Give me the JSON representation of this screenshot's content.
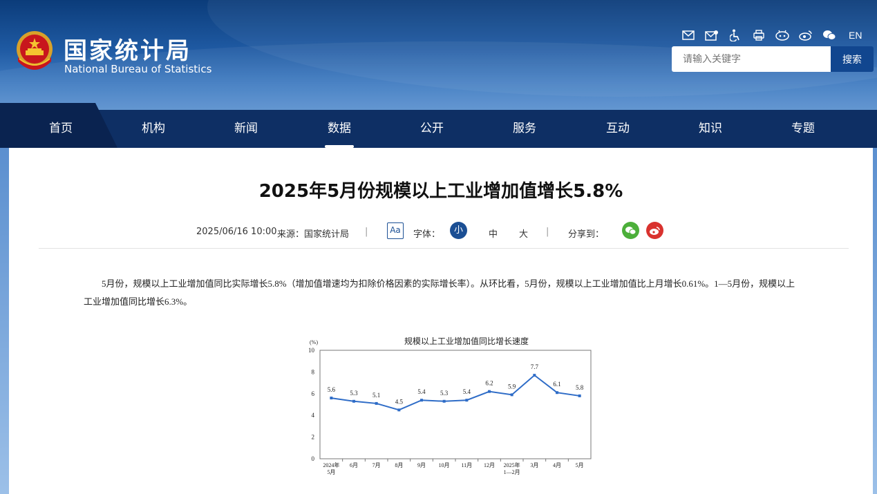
{
  "header": {
    "logo_cn": "国家统计局",
    "logo_en": "National Bureau of Statistics",
    "lang_toggle": "EN",
    "search_placeholder": "请输入关键字",
    "search_button": "搜索",
    "tool_icons": [
      "mail-icon",
      "mailbox-icon",
      "accessibility-icon",
      "print-icon",
      "mini-program-icon",
      "weibo-icon",
      "wechat-icon"
    ]
  },
  "nav": {
    "items": [
      "首页",
      "机构",
      "新闻",
      "数据",
      "公开",
      "服务",
      "互动",
      "知识",
      "专题"
    ],
    "active": "数据"
  },
  "article": {
    "title": "2025年5月份规模以上工业增加值增长5.8%",
    "date": "2025/06/16 10:00",
    "source": "来源：国家统计局",
    "aa_label": "Aa",
    "font_label": "字体：",
    "size_small": "小",
    "size_medium": "中",
    "size_large": "大",
    "share_label": "分享到：",
    "separator": "|",
    "paragraph": "5月份，规模以上工业增加值同比实际增长5.8%（增加值增速均为扣除价格因素的实际增长率）。从环比看，5月份，规模以上工业增加值比上月增长0.61%。1—5月份，规模以上工业增加值同比增长6.3%。"
  },
  "chart_data": {
    "type": "line",
    "title": "规模以上工业增加值同比增长速度",
    "ylabel": "(%)",
    "ylim": [
      0,
      10
    ],
    "yticks": [
      0,
      2,
      4,
      6,
      8,
      10
    ],
    "categories": [
      [
        "2024年",
        "5月"
      ],
      [
        "6月"
      ],
      [
        "7月"
      ],
      [
        "8月"
      ],
      [
        "9月"
      ],
      [
        "10月"
      ],
      [
        "11月"
      ],
      [
        "12月"
      ],
      [
        "2025年",
        "1—2月"
      ],
      [
        "3月"
      ],
      [
        "4月"
      ],
      [
        "5月"
      ]
    ],
    "values": [
      5.6,
      5.3,
      5.1,
      4.5,
      5.4,
      5.3,
      5.4,
      6.2,
      5.9,
      7.7,
      6.1,
      5.8
    ],
    "data_labels": [
      "5.6",
      "5.3",
      "5.1",
      "4.5",
      "5.4",
      "5.3",
      "5.4",
      "6.2",
      "5.9",
      "7.7",
      "6.1",
      "5.8"
    ],
    "line_color": "#2e6cc7"
  }
}
